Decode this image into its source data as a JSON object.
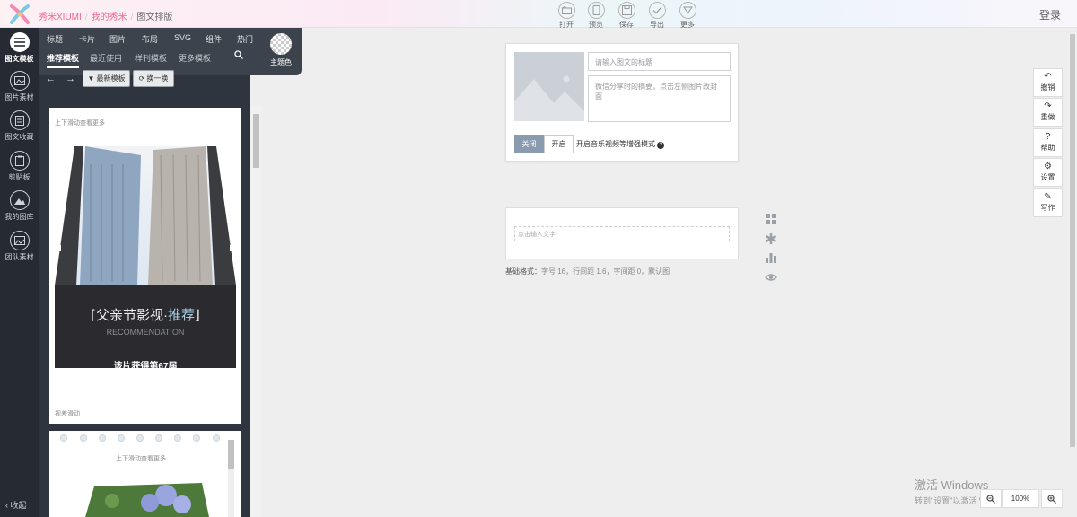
{
  "header": {
    "brand": "秀米XIUMI",
    "breadcrumb": [
      "我的秀米",
      "图文排版"
    ],
    "toolbar": [
      {
        "label": "打开",
        "icon": "folder-icon"
      },
      {
        "label": "预览",
        "icon": "preview-icon"
      },
      {
        "label": "保存",
        "icon": "save-icon"
      },
      {
        "label": "导出",
        "icon": "export-icon"
      },
      {
        "label": "更多",
        "icon": "more-icon"
      }
    ],
    "login": "登录"
  },
  "rail": {
    "items": [
      {
        "label": "图文模板",
        "icon": "list-icon"
      },
      {
        "label": "图片素材",
        "icon": "image-icon"
      },
      {
        "label": "图文收藏",
        "icon": "collection-icon"
      },
      {
        "label": "剪贴板",
        "icon": "clipboard-icon"
      },
      {
        "label": "我的图库",
        "icon": "gallery-icon"
      },
      {
        "label": "团队素材",
        "icon": "team-icon"
      }
    ],
    "collapse": "收起"
  },
  "tabs": {
    "categories": [
      "标题",
      "卡片",
      "图片",
      "布局",
      "SVG",
      "组件",
      "热门"
    ],
    "subtabs": [
      "推荐模板",
      "最近使用",
      "样刊模板",
      "更多模板"
    ],
    "theme_label": "主题色"
  },
  "panel": {
    "latest_btn": "最新模板",
    "shuffle_btn": "换一换",
    "card1": {
      "top_hint": "上下滑动查看更多",
      "title_left": "父亲节影视·",
      "title_right": "推荐",
      "subtitle": "RECOMMENDATION",
      "text": "该片获得第67届",
      "bottom_hint": "视差滑动"
    },
    "card2": {
      "top_hint": "上下滑动查看更多"
    }
  },
  "editor": {
    "title_placeholder": "请输入图文的标题",
    "summary_placeholder": "微信分享时的摘要，点击左侧图片改封面",
    "toggle_off": "关闭",
    "toggle_on": "开启",
    "toggle_label": "开启音乐视频等增强模式",
    "text_placeholder": "点击输入文字",
    "base_label": "基础格式：",
    "base_value": "字号 16，行间距 1.6，字间距 0，默认图"
  },
  "right_tools": [
    {
      "label": "撤销",
      "glyph": "↶"
    },
    {
      "label": "重做",
      "glyph": "↷"
    },
    {
      "label": "帮助",
      "glyph": "?"
    },
    {
      "label": "设置",
      "glyph": "⚙"
    },
    {
      "label": "写作",
      "glyph": "✎"
    }
  ],
  "zoom": {
    "value": "100%"
  },
  "watermark": {
    "line1": "激活 Windows",
    "line2": "转到\"设置\"以激活 Windows。"
  },
  "colors": {
    "accent": "#ed6690",
    "dark": "#262b33",
    "toggle_active": "#8a9bb0"
  }
}
